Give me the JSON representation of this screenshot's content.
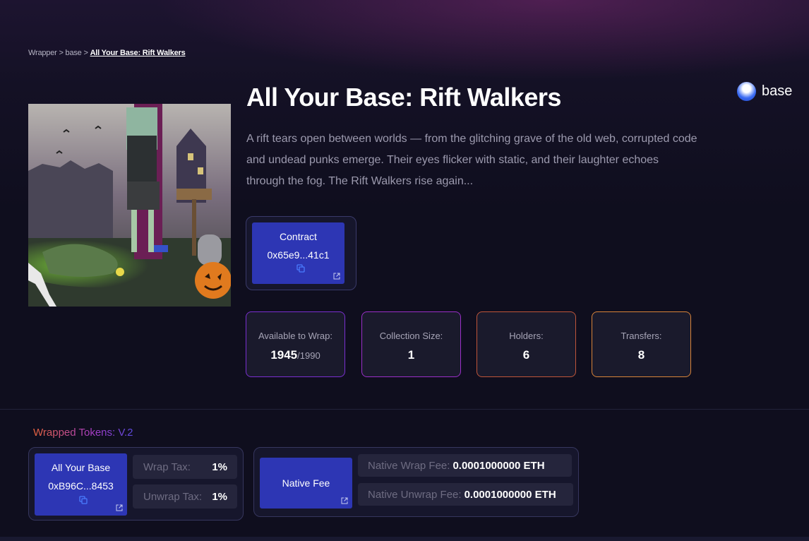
{
  "breadcrumb": {
    "items": [
      "Wrapper",
      "base"
    ],
    "separator": ">",
    "current": "All Your Base: Rift Walkers"
  },
  "collection": {
    "title": "All Your Base: Rift Walkers",
    "chain": "base",
    "description": "A rift tears open between worlds — from the glitching grave of the old web, corrupted code and undead punks emerge. Their eyes flicker with static, and their laughter echoes through the fog. The Rift Walkers rise again..."
  },
  "contract": {
    "label": "Contract",
    "address": "0x65e9...41c1"
  },
  "stats": [
    {
      "label": "Available to Wrap:",
      "value": "1945",
      "suffix": "/1990",
      "border": "#7a2fd0"
    },
    {
      "label": "Collection Size:",
      "value": "1",
      "suffix": "",
      "border": "#9a2fc8"
    },
    {
      "label": "Holders:",
      "value": "6",
      "suffix": "",
      "border": "#c0553a"
    },
    {
      "label": "Transfers:",
      "value": "8",
      "suffix": "",
      "border": "#d9843a"
    }
  ],
  "wrapped": {
    "section_title": "Wrapped Tokens: V.2",
    "token_name": "All Your Base",
    "token_address": "0xB96C...8453",
    "wrap_tax_label": "Wrap Tax:",
    "wrap_tax_value": "1%",
    "unwrap_tax_label": "Unwrap Tax:",
    "unwrap_tax_value": "1%"
  },
  "native_fee": {
    "label": "Native Fee",
    "wrap_fee_label": "Native Wrap Fee:",
    "wrap_fee_value": "0.0001000000 ETH",
    "unwrap_fee_label": "Native Unwrap Fee:",
    "unwrap_fee_value": "0.0001000000 ETH"
  },
  "colors": {
    "accent_blue": "#2d36b4",
    "background": "#0f0e1e"
  },
  "icons": [
    "copy-icon",
    "external-link-icon",
    "base-chain-icon"
  ]
}
